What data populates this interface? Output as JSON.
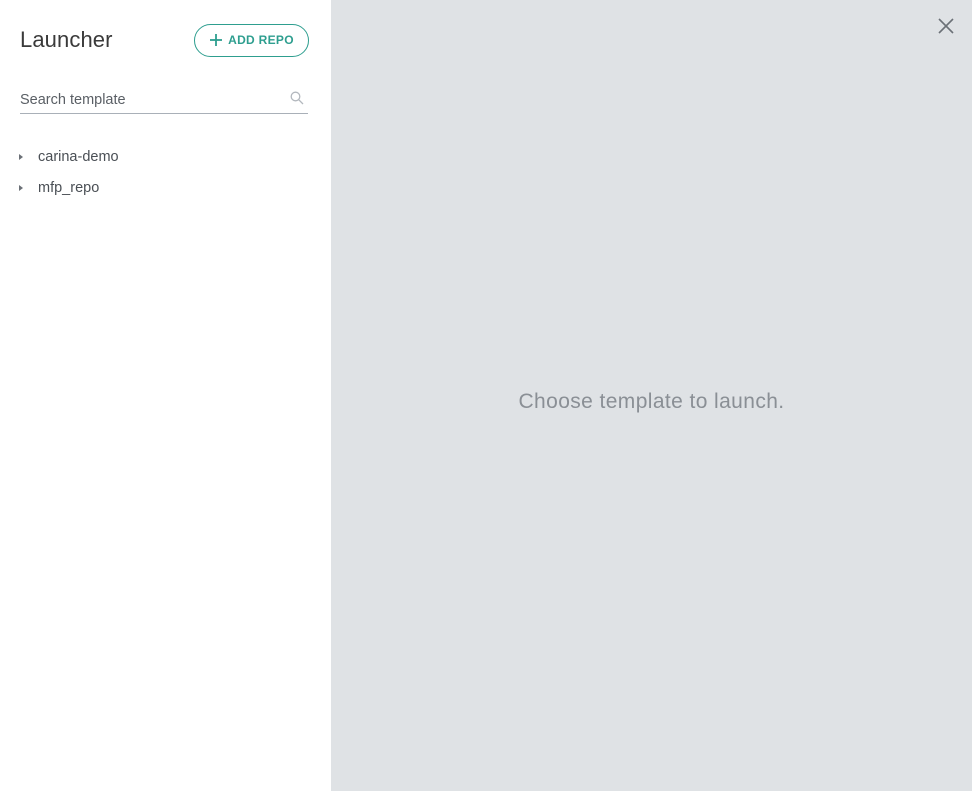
{
  "sidebar": {
    "title": "Launcher",
    "add_repo_label": "ADD REPO",
    "search_placeholder": "Search template",
    "search_value": "",
    "repos": [
      {
        "label": "carina-demo"
      },
      {
        "label": "mfp_repo"
      }
    ]
  },
  "main": {
    "empty_message": "Choose template to launch."
  },
  "icons": {
    "add": "plus-icon",
    "search": "search-icon",
    "expand": "caret-right-icon",
    "close": "close-icon"
  },
  "colors": {
    "accent": "#2e9e8f",
    "main_background": "#dfe2e5",
    "sidebar_background": "#ffffff"
  }
}
